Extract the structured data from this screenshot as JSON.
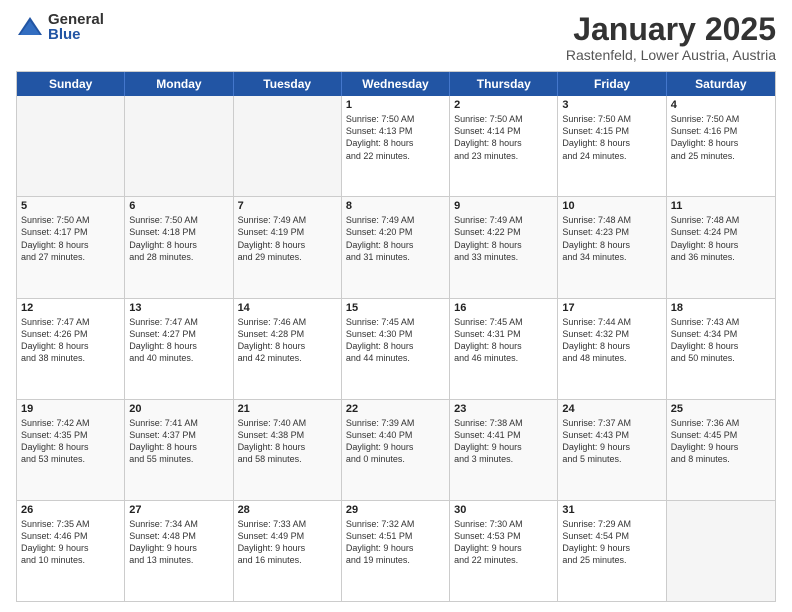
{
  "logo": {
    "general": "General",
    "blue": "Blue"
  },
  "title": {
    "month": "January 2025",
    "location": "Rastenfeld, Lower Austria, Austria"
  },
  "header_days": [
    "Sunday",
    "Monday",
    "Tuesday",
    "Wednesday",
    "Thursday",
    "Friday",
    "Saturday"
  ],
  "rows": [
    [
      {
        "day": "",
        "text": "",
        "empty": true
      },
      {
        "day": "",
        "text": "",
        "empty": true
      },
      {
        "day": "",
        "text": "",
        "empty": true
      },
      {
        "day": "1",
        "text": "Sunrise: 7:50 AM\nSunset: 4:13 PM\nDaylight: 8 hours\nand 22 minutes.",
        "empty": false
      },
      {
        "day": "2",
        "text": "Sunrise: 7:50 AM\nSunset: 4:14 PM\nDaylight: 8 hours\nand 23 minutes.",
        "empty": false
      },
      {
        "day": "3",
        "text": "Sunrise: 7:50 AM\nSunset: 4:15 PM\nDaylight: 8 hours\nand 24 minutes.",
        "empty": false
      },
      {
        "day": "4",
        "text": "Sunrise: 7:50 AM\nSunset: 4:16 PM\nDaylight: 8 hours\nand 25 minutes.",
        "empty": false
      }
    ],
    [
      {
        "day": "5",
        "text": "Sunrise: 7:50 AM\nSunset: 4:17 PM\nDaylight: 8 hours\nand 27 minutes.",
        "empty": false
      },
      {
        "day": "6",
        "text": "Sunrise: 7:50 AM\nSunset: 4:18 PM\nDaylight: 8 hours\nand 28 minutes.",
        "empty": false
      },
      {
        "day": "7",
        "text": "Sunrise: 7:49 AM\nSunset: 4:19 PM\nDaylight: 8 hours\nand 29 minutes.",
        "empty": false
      },
      {
        "day": "8",
        "text": "Sunrise: 7:49 AM\nSunset: 4:20 PM\nDaylight: 8 hours\nand 31 minutes.",
        "empty": false
      },
      {
        "day": "9",
        "text": "Sunrise: 7:49 AM\nSunset: 4:22 PM\nDaylight: 8 hours\nand 33 minutes.",
        "empty": false
      },
      {
        "day": "10",
        "text": "Sunrise: 7:48 AM\nSunset: 4:23 PM\nDaylight: 8 hours\nand 34 minutes.",
        "empty": false
      },
      {
        "day": "11",
        "text": "Sunrise: 7:48 AM\nSunset: 4:24 PM\nDaylight: 8 hours\nand 36 minutes.",
        "empty": false
      }
    ],
    [
      {
        "day": "12",
        "text": "Sunrise: 7:47 AM\nSunset: 4:26 PM\nDaylight: 8 hours\nand 38 minutes.",
        "empty": false
      },
      {
        "day": "13",
        "text": "Sunrise: 7:47 AM\nSunset: 4:27 PM\nDaylight: 8 hours\nand 40 minutes.",
        "empty": false
      },
      {
        "day": "14",
        "text": "Sunrise: 7:46 AM\nSunset: 4:28 PM\nDaylight: 8 hours\nand 42 minutes.",
        "empty": false
      },
      {
        "day": "15",
        "text": "Sunrise: 7:45 AM\nSunset: 4:30 PM\nDaylight: 8 hours\nand 44 minutes.",
        "empty": false
      },
      {
        "day": "16",
        "text": "Sunrise: 7:45 AM\nSunset: 4:31 PM\nDaylight: 8 hours\nand 46 minutes.",
        "empty": false
      },
      {
        "day": "17",
        "text": "Sunrise: 7:44 AM\nSunset: 4:32 PM\nDaylight: 8 hours\nand 48 minutes.",
        "empty": false
      },
      {
        "day": "18",
        "text": "Sunrise: 7:43 AM\nSunset: 4:34 PM\nDaylight: 8 hours\nand 50 minutes.",
        "empty": false
      }
    ],
    [
      {
        "day": "19",
        "text": "Sunrise: 7:42 AM\nSunset: 4:35 PM\nDaylight: 8 hours\nand 53 minutes.",
        "empty": false
      },
      {
        "day": "20",
        "text": "Sunrise: 7:41 AM\nSunset: 4:37 PM\nDaylight: 8 hours\nand 55 minutes.",
        "empty": false
      },
      {
        "day": "21",
        "text": "Sunrise: 7:40 AM\nSunset: 4:38 PM\nDaylight: 8 hours\nand 58 minutes.",
        "empty": false
      },
      {
        "day": "22",
        "text": "Sunrise: 7:39 AM\nSunset: 4:40 PM\nDaylight: 9 hours\nand 0 minutes.",
        "empty": false
      },
      {
        "day": "23",
        "text": "Sunrise: 7:38 AM\nSunset: 4:41 PM\nDaylight: 9 hours\nand 3 minutes.",
        "empty": false
      },
      {
        "day": "24",
        "text": "Sunrise: 7:37 AM\nSunset: 4:43 PM\nDaylight: 9 hours\nand 5 minutes.",
        "empty": false
      },
      {
        "day": "25",
        "text": "Sunrise: 7:36 AM\nSunset: 4:45 PM\nDaylight: 9 hours\nand 8 minutes.",
        "empty": false
      }
    ],
    [
      {
        "day": "26",
        "text": "Sunrise: 7:35 AM\nSunset: 4:46 PM\nDaylight: 9 hours\nand 10 minutes.",
        "empty": false
      },
      {
        "day": "27",
        "text": "Sunrise: 7:34 AM\nSunset: 4:48 PM\nDaylight: 9 hours\nand 13 minutes.",
        "empty": false
      },
      {
        "day": "28",
        "text": "Sunrise: 7:33 AM\nSunset: 4:49 PM\nDaylight: 9 hours\nand 16 minutes.",
        "empty": false
      },
      {
        "day": "29",
        "text": "Sunrise: 7:32 AM\nSunset: 4:51 PM\nDaylight: 9 hours\nand 19 minutes.",
        "empty": false
      },
      {
        "day": "30",
        "text": "Sunrise: 7:30 AM\nSunset: 4:53 PM\nDaylight: 9 hours\nand 22 minutes.",
        "empty": false
      },
      {
        "day": "31",
        "text": "Sunrise: 7:29 AM\nSunset: 4:54 PM\nDaylight: 9 hours\nand 25 minutes.",
        "empty": false
      },
      {
        "day": "",
        "text": "",
        "empty": true
      }
    ]
  ]
}
